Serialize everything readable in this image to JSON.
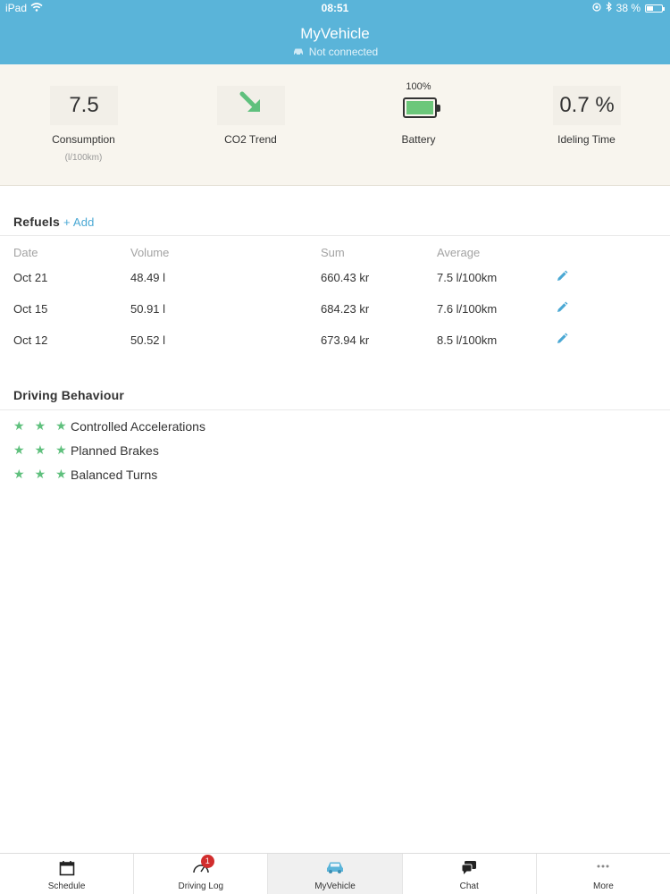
{
  "status_bar": {
    "device": "iPad",
    "time": "08:51",
    "battery": "38 %"
  },
  "header": {
    "title": "MyVehicle",
    "connection_status": "Not connected",
    "background_color": "#5ab4d9"
  },
  "stats": {
    "consumption": {
      "value": "7.5",
      "label": "Consumption",
      "unit": "(l/100km)"
    },
    "co2_trend": {
      "label": "CO2 Trend",
      "icon": "arrow-down-right-icon",
      "color": "#5fc07d"
    },
    "battery": {
      "percent": "100%",
      "label": "Battery",
      "level": 1.0,
      "color": "#6cc77a"
    },
    "idling": {
      "value": "0.7 %",
      "label": "Ideling Time"
    }
  },
  "refuels": {
    "title": "Refuels",
    "add_label": "+ Add",
    "columns": [
      "Date",
      "Volume",
      "Sum",
      "Average"
    ],
    "rows": [
      {
        "date": "Oct 21",
        "volume": "48.49 l",
        "sum": "660.43 kr",
        "average": "7.5 l/100km"
      },
      {
        "date": "Oct 15",
        "volume": "50.91 l",
        "sum": "684.23 kr",
        "average": "7.6 l/100km"
      },
      {
        "date": "Oct 12",
        "volume": "50.52 l",
        "sum": "673.94 kr",
        "average": "8.5 l/100km"
      }
    ]
  },
  "driving_behaviour": {
    "title": "Driving Behaviour",
    "items": [
      {
        "label": "Controlled Accelerations",
        "stars": 3
      },
      {
        "label": "Planned Brakes",
        "stars": 3
      },
      {
        "label": "Balanced Turns",
        "stars": 3
      }
    ],
    "star_color": "#5fc07d"
  },
  "tabs": [
    {
      "label": "Schedule",
      "icon": "calendar-icon"
    },
    {
      "label": "Driving Log",
      "icon": "speedometer-icon",
      "badge": "1"
    },
    {
      "label": "MyVehicle",
      "icon": "car-icon",
      "active": true
    },
    {
      "label": "Chat",
      "icon": "chat-icon"
    },
    {
      "label": "More",
      "icon": "more-icon"
    }
  ]
}
